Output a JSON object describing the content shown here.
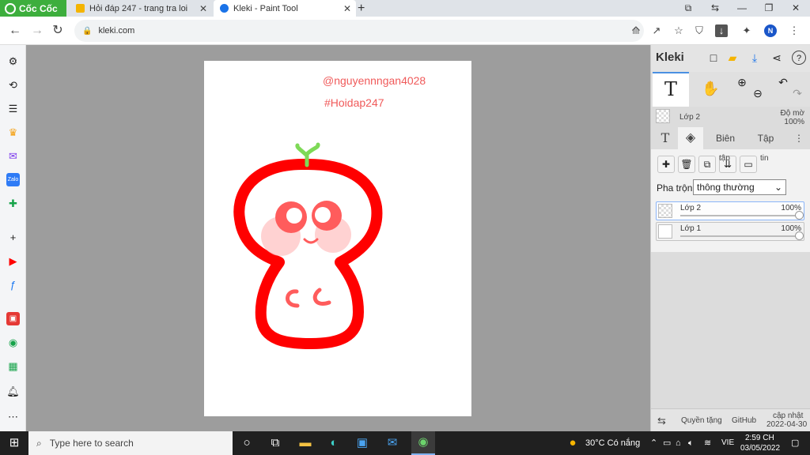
{
  "browser": {
    "brand_label": "Cốc Cốc",
    "tabs": [
      {
        "title": "Hỏi đáp 247 - trang tra loi",
        "active": false
      },
      {
        "title": "Kleki - Paint Tool",
        "active": true
      }
    ],
    "url": "kleki.com",
    "profile_initial": "N"
  },
  "canvas": {
    "watermark_user": "@nguyennngan4028",
    "watermark_tag": "#Hoidap247",
    "bg_color": "#9d9d9d",
    "stroke_color": "#ff0000"
  },
  "kleki": {
    "logo_label": "Kleki",
    "active_tool_glyph": "T",
    "current_layer": {
      "name": "Lớp 2",
      "opacity_label": "Độ mờ",
      "opacity_value": "100%"
    },
    "tabs": [
      "Biên",
      "Tập"
    ],
    "layer_buttons": {
      "merge_label": "tập",
      "rename_label": "tin"
    },
    "blend_label": "Pha trộn",
    "blend_value": "thông thường",
    "layers": [
      {
        "name": "Lớp 2",
        "opacity": "100%",
        "selected": true
      },
      {
        "name": "Lớp 1",
        "opacity": "100%",
        "selected": false
      }
    ],
    "footer": {
      "copyright": "Quyền tặng",
      "github": "GitHub",
      "update_label": "cập nhật",
      "update_date": "2022-04-30"
    }
  },
  "taskbar": {
    "search_placeholder": "Type here to search",
    "weather": "30°C  Có nắng",
    "lang": "VIE",
    "time": "2:59 CH",
    "date": "03/05/2022"
  }
}
